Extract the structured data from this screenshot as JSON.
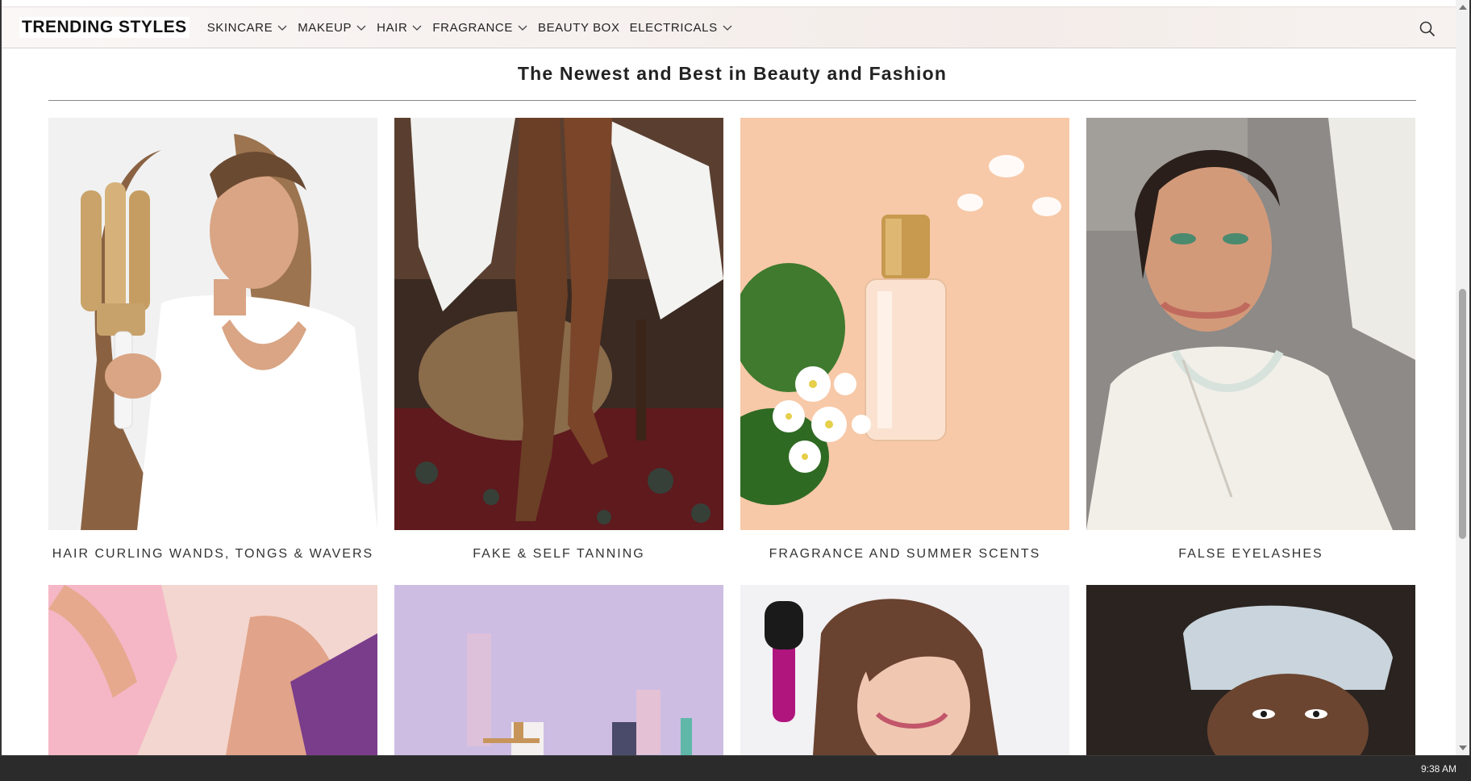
{
  "nav": {
    "brand": "TRENDING STYLES",
    "items": [
      {
        "label": "SKINCARE",
        "dropdown": true
      },
      {
        "label": "MAKEUP",
        "dropdown": true
      },
      {
        "label": "HAIR",
        "dropdown": true
      },
      {
        "label": "FRAGRANCE",
        "dropdown": true
      },
      {
        "label": "BEAUTY BOX",
        "dropdown": false
      },
      {
        "label": "ELECTRICALS",
        "dropdown": true
      }
    ],
    "search_icon": "search-icon"
  },
  "section": {
    "heading": "The Newest and Best in Beauty and Fashion"
  },
  "cards": [
    {
      "label": "HAIR CURLING WANDS, TONGS & WAVERS",
      "image": "woman-with-hair-waver"
    },
    {
      "label": "FAKE & SELF TANNING",
      "image": "tanned-legs-on-chair"
    },
    {
      "label": "FRAGRANCE AND SUMMER SCENTS",
      "image": "perfume-bottle-with-flowers"
    },
    {
      "label": "FALSE EYELASHES",
      "image": "woman-with-makeup-and-necklace"
    }
  ],
  "cards_row2": [
    {
      "image": "pink-wax-application"
    },
    {
      "image": "makeup-products-lilac-background"
    },
    {
      "image": "woman-brushing-hair"
    },
    {
      "image": "woman-in-towel-skincare"
    }
  ],
  "taskbar": {
    "time": "9:38 AM"
  },
  "colors": {
    "nav_bg": "#f6f0ee",
    "text": "#222222",
    "taskbar": "#2b2b2b"
  }
}
